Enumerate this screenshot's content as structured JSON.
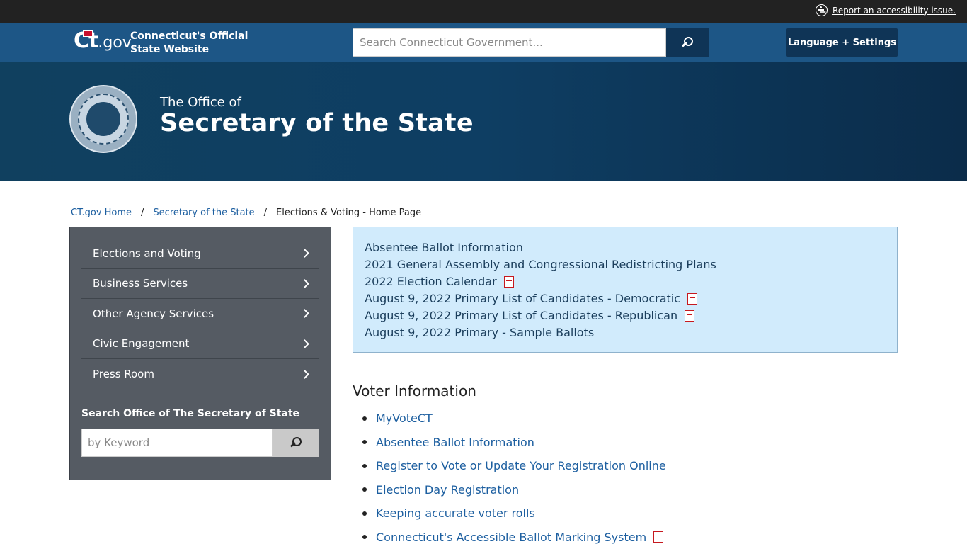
{
  "utility": {
    "accessibility_label": "Report an accessibility issue."
  },
  "ct_header": {
    "logo_text": "Ct",
    "logo_suffix": ".gov",
    "title_line1": "Connecticut's Official",
    "title_line2": "State Website",
    "search_placeholder": "Search Connecticut Government...",
    "language_button": "Language + Settings"
  },
  "banner": {
    "pre_title": "The Office of",
    "title": "Secretary of the State"
  },
  "breadcrumb": [
    {
      "label": "CT.gov Home",
      "link": true
    },
    {
      "label": "Secretary of the State",
      "link": true
    },
    {
      "label": "Elections & Voting - Home Page",
      "link": false
    }
  ],
  "sidebar": {
    "items": [
      {
        "label": "Elections and Voting"
      },
      {
        "label": "Business Services"
      },
      {
        "label": "Other Agency Services"
      },
      {
        "label": "Civic Engagement"
      },
      {
        "label": "Press Room"
      }
    ],
    "search_title": "Search Office of The Secretary of State",
    "search_placeholder": "by Keyword"
  },
  "alert_links": [
    {
      "label": "Absentee Ballot Information",
      "pdf": false
    },
    {
      "label": "2021 General Assembly and Congressional Redistricting Plans",
      "pdf": false
    },
    {
      "label": "2022 Election Calendar",
      "pdf": true
    },
    {
      "label": "August 9, 2022 Primary List of Candidates - Democratic",
      "pdf": true
    },
    {
      "label": "August 9, 2022 Primary List of Candidates - Republican",
      "pdf": true
    },
    {
      "label": "August 9, 2022 Primary - Sample Ballots",
      "pdf": false
    }
  ],
  "voter_info": {
    "title": "Voter Information",
    "links": [
      {
        "label": "MyVoteCT",
        "pdf": false
      },
      {
        "label": "Absentee Ballot Information",
        "pdf": false
      },
      {
        "label": "Register to Vote or Update Your Registration Online",
        "pdf": false
      },
      {
        "label": "Election Day Registration",
        "pdf": false
      },
      {
        "label": "Keeping accurate voter rolls",
        "pdf": false
      },
      {
        "label": "Connecticut's Accessible Ballot Marking System",
        "pdf": true
      }
    ]
  },
  "colors": {
    "utility_bg": "#222222",
    "header_bg": "#1d5686",
    "banner_bg": "#10405f",
    "sidebar_bg": "#555b63",
    "alert_bg": "#d1ebfc",
    "link": "#1d5fa0"
  }
}
